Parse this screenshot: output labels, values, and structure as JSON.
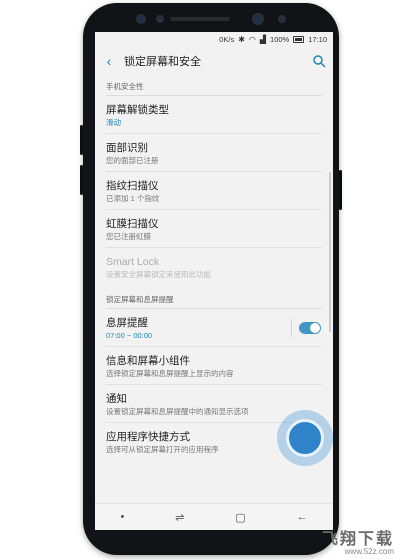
{
  "status_bar": {
    "speed": "0K/s",
    "battery": "100%",
    "time": "17:10"
  },
  "header": {
    "title": "锁定屏幕和安全"
  },
  "sections": [
    {
      "label": "手机安全性"
    },
    {
      "label": "锁定屏幕和息屏提醒"
    }
  ],
  "items": [
    {
      "title": "屏幕解锁类型",
      "subtitle": "滑动"
    },
    {
      "title": "面部识别",
      "subtitle": "您的面部已注册"
    },
    {
      "title": "指纹扫描仪",
      "subtitle": "已添加 1 个指纹"
    },
    {
      "title": "虹膜扫描仪",
      "subtitle": "您已注册虹膜"
    },
    {
      "title": "Smart Lock",
      "subtitle": "设置安全屏幕锁定来使用此功能"
    },
    {
      "title": "息屏提醒",
      "subtitle": "07:00 ~ 00:00",
      "toggle_on": true
    },
    {
      "title": "信息和屏幕小组件",
      "subtitle": "选择锁定屏幕和息屏提醒上显示的内容"
    },
    {
      "title": "通知",
      "subtitle": "设置锁定屏幕和息屏提醒中的通知显示选项"
    },
    {
      "title": "应用程序快捷方式",
      "subtitle": "选择可从锁定屏幕打开的应用程序"
    }
  ],
  "watermark": {
    "brand": "飞翔下载",
    "url": "www.52z.com"
  },
  "colors": {
    "accent": "#1e88b9",
    "toggle": "#3f97c4",
    "touch": "#2f84c9"
  }
}
